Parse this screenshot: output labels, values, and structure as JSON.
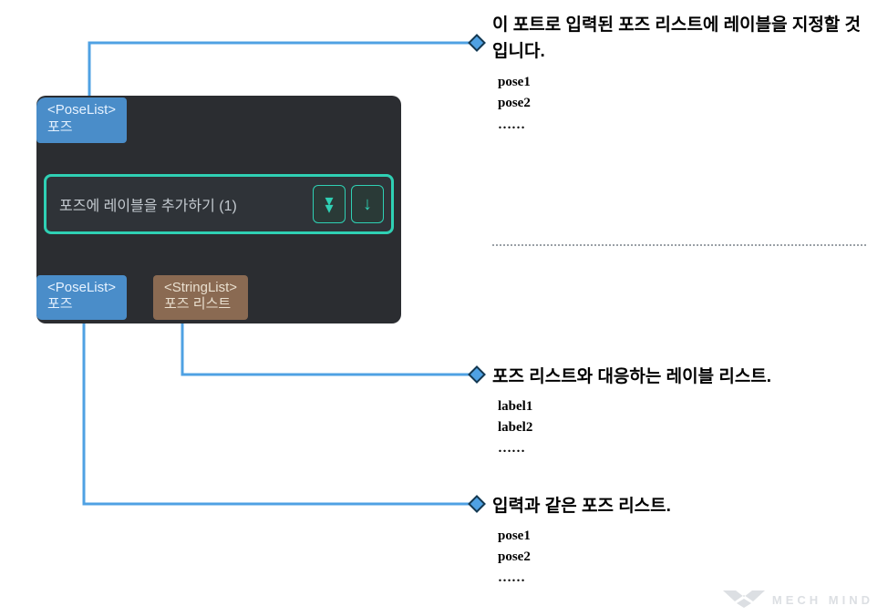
{
  "colors": {
    "panel_bg": "#2b2d31",
    "port_blue": "#4a8dc9",
    "port_brown": "#8a6a52",
    "node_border": "#2fd0b4",
    "connector": "#4fa1e3"
  },
  "node": {
    "title": "포즈에 레이블을 추가하기 (1)",
    "input_port": {
      "type": "<PoseList>",
      "name": "포즈"
    },
    "output_port1": {
      "type": "<PoseList>",
      "name": "포즈"
    },
    "output_port2": {
      "type": "<StringList>",
      "name": "포즈 리스트"
    },
    "icons": {
      "expand": "expand-down-icon",
      "run": "arrow-down-icon"
    }
  },
  "annotations": {
    "note1": {
      "title": "이 포트로 입력된 포즈 리스트에 레이블을 지정할 것입니다.",
      "samples": [
        "pose1",
        "pose2",
        "……"
      ]
    },
    "note2": {
      "title": "포즈 리스트와 대응하는 레이블 리스트.",
      "samples": [
        "label1",
        "label2",
        "……"
      ]
    },
    "note3": {
      "title": "입력과 같은 포즈 리스트.",
      "samples": [
        "pose1",
        "pose2",
        "……"
      ]
    }
  },
  "watermark": "MECH MIND"
}
